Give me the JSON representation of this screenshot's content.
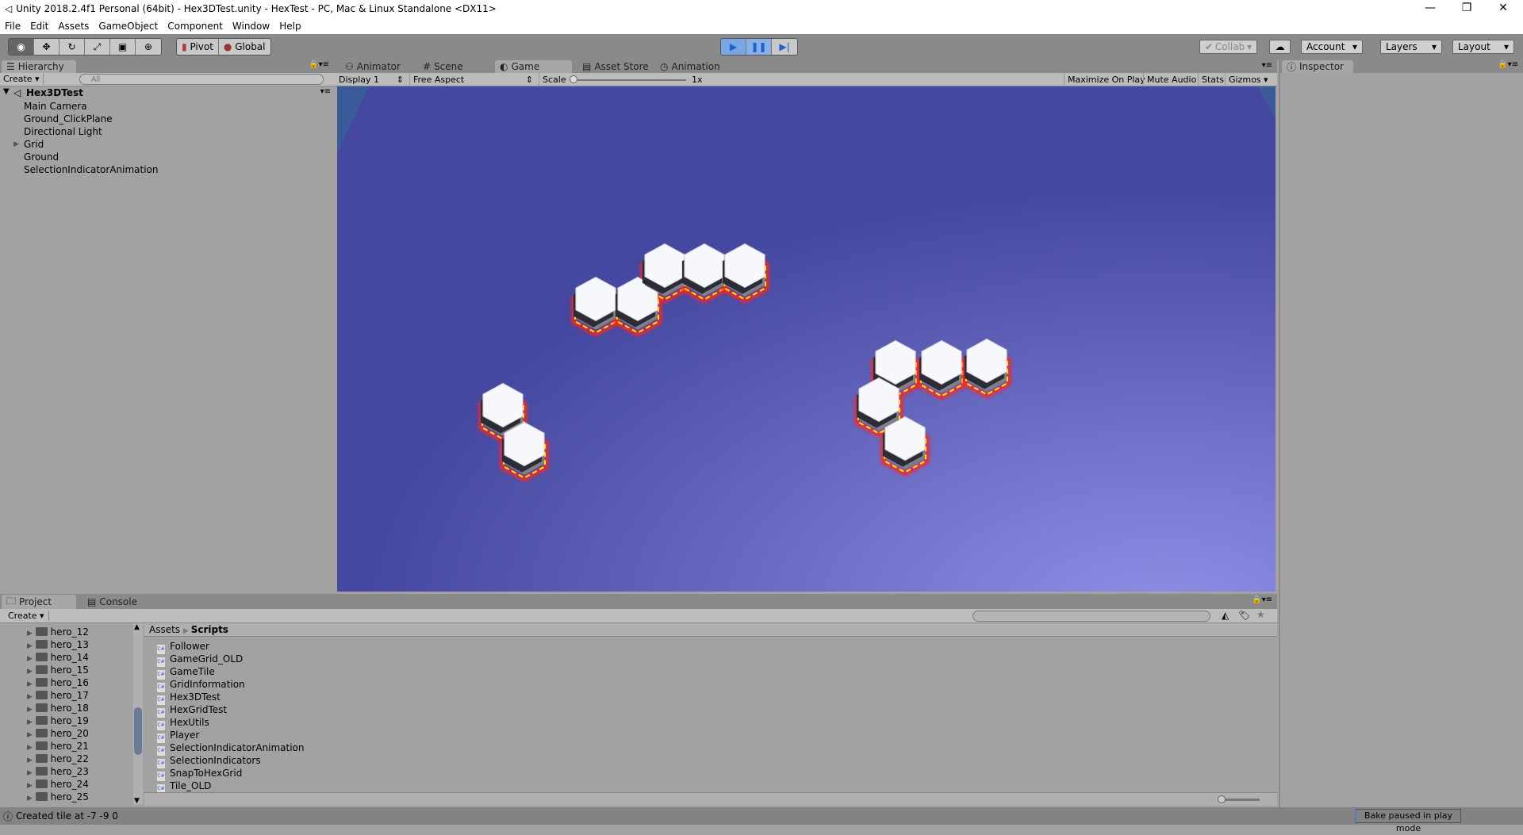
{
  "window": {
    "title": "Unity 2018.2.4f1 Personal (64bit) - Hex3DTest.unity - HexTest - PC, Mac & Linux Standalone <DX11>",
    "minimize": "—",
    "restore": "❐",
    "close": "✕"
  },
  "menu": [
    "File",
    "Edit",
    "Assets",
    "GameObject",
    "Component",
    "Window",
    "Help"
  ],
  "toolbar": {
    "pivot": "Pivot",
    "global": "Global",
    "collab": "Collab",
    "account": "Account",
    "layers": "Layers",
    "layout": "Layout",
    "accent": "#2e6fd6"
  },
  "hierarchy": {
    "tab": "Hierarchy",
    "create": "Create",
    "search_placeholder": "All",
    "scene": "Hex3DTest",
    "items": [
      "Main Camera",
      "Ground_ClickPlane",
      "Directional Light",
      "Grid",
      "Ground",
      "SelectionIndicatorAnimation"
    ]
  },
  "center_tabs": [
    "Animator",
    "Scene",
    "Game",
    "Asset Store",
    "Animation"
  ],
  "game": {
    "display": "Display 1",
    "aspect": "Free Aspect",
    "scale_label": "Scale",
    "scale_value": "1x",
    "maximize": "Maximize On Play",
    "mute": "Mute Audio",
    "stats": "Stats",
    "gizmos": "Gizmos",
    "bg_top": "#4548a0",
    "bg_bottom": "#8f8fe6"
  },
  "inspector": {
    "tab": "Inspector"
  },
  "project": {
    "tab": "Project",
    "console_tab": "Console",
    "create": "Create",
    "folders": [
      "hero_12",
      "hero_13",
      "hero_14",
      "hero_15",
      "hero_16",
      "hero_17",
      "hero_18",
      "hero_19",
      "hero_20",
      "hero_21",
      "hero_22",
      "hero_23",
      "hero_24",
      "hero_25"
    ],
    "breadcrumb": [
      "Assets",
      "Scripts"
    ],
    "files": [
      "Follower",
      "GameGrid_OLD",
      "GameTile",
      "GridInformation",
      "Hex3DTest",
      "HexGridTest",
      "HexUtils",
      "Player",
      "SelectionIndicatorAnimation",
      "SelectionIndicators",
      "SnapToHexGrid",
      "Tile_OLD"
    ],
    "file_icon": "C#"
  },
  "status": {
    "message": "Created tile at -7 -9 0",
    "bake": "Bake paused in play mode"
  }
}
